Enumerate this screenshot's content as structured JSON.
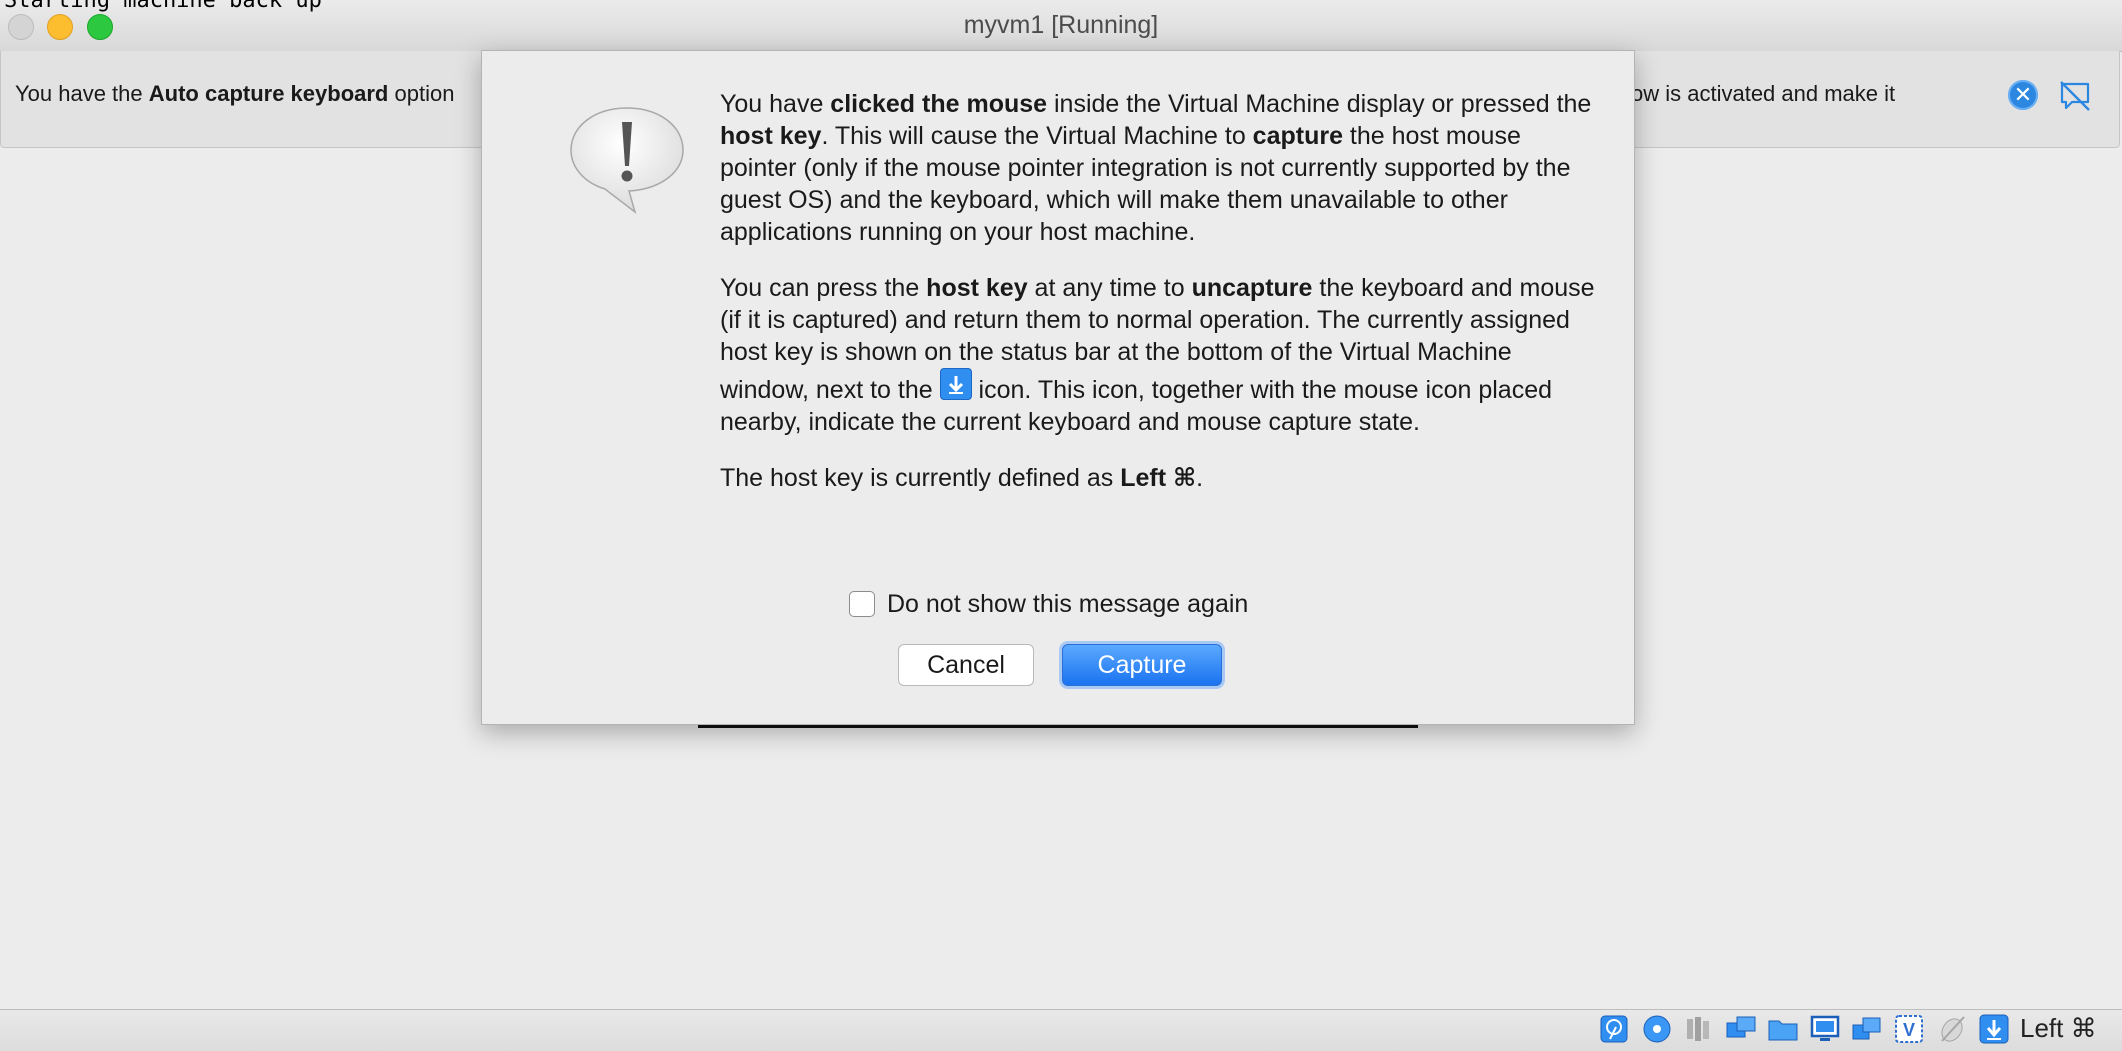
{
  "window": {
    "title": "myvm1 [Running]",
    "background_console_text": "Starting machine back up"
  },
  "banner": {
    "text_prefix": "You have the ",
    "text_bold": "Auto capture keyboard",
    "text_suffix": " option",
    "text_right": "ow is activated and make it"
  },
  "dialog": {
    "p1": [
      {
        "t": "You have ",
        "b": false
      },
      {
        "t": "clicked the mouse",
        "b": true
      },
      {
        "t": " inside the Virtual Machine display or pressed the ",
        "b": false
      },
      {
        "t": "host key",
        "b": true
      },
      {
        "t": ". This will cause the Virtual Machine to ",
        "b": false
      },
      {
        "t": "capture",
        "b": true
      },
      {
        "t": " the host mouse pointer (only if the mouse pointer integration is not currently supported by the guest OS) and the keyboard, which will make them unavailable to other applications running on your host machine.",
        "b": false
      }
    ],
    "p2a": [
      {
        "t": "You can press the ",
        "b": false
      },
      {
        "t": "host key",
        "b": true
      },
      {
        "t": " at any time to ",
        "b": false
      },
      {
        "t": "uncapture",
        "b": true
      },
      {
        "t": " the keyboard and mouse (if it is captured) and return them to normal operation. The currently assigned host key is shown on the status bar at the bottom of the Virtual Machine window, next to the ",
        "b": false
      }
    ],
    "p2b": " icon. This icon, together with the mouse icon placed nearby, indicate the current keyboard and mouse capture state.",
    "p3_prefix": "The host key is currently defined as ",
    "p3_key": "Left ⌘",
    "p3_suffix": ".",
    "checkbox_label": "Do not show this message again",
    "checkbox_checked": false,
    "cancel_label": "Cancel",
    "capture_label": "Capture"
  },
  "statusbar": {
    "icons": [
      "hard-disk-icon",
      "optical-drive-icon",
      "audio-icon",
      "network-icon",
      "shared-folder-icon",
      "display-icon",
      "video-capture-icon",
      "vt-x-icon",
      "mouse-integration-icon",
      "host-key-icon"
    ],
    "host_key_label": "Left ⌘"
  },
  "colors": {
    "accent": "#1a73f0",
    "banner_close": "#2c87e0",
    "traffic_min": "#fcbd2f",
    "traffic_max": "#2bc840"
  }
}
